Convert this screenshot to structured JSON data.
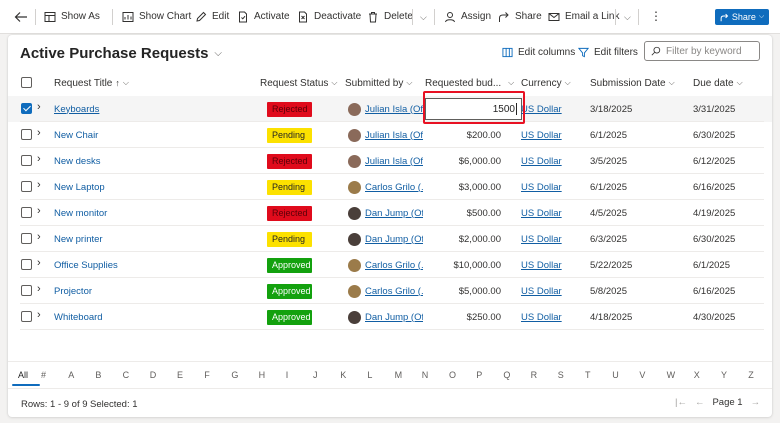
{
  "toolbar": {
    "show_as": "Show As",
    "show_chart": "Show Chart",
    "edit": "Edit",
    "activate": "Activate",
    "deactivate": "Deactivate",
    "delete": "Delete",
    "assign": "Assign",
    "share": "Share",
    "email_link": "Email a Link",
    "share_button": "Share"
  },
  "view": {
    "title": "Active Purchase Requests",
    "edit_columns": "Edit columns",
    "edit_filters": "Edit filters",
    "search_placeholder": "Filter by keyword"
  },
  "columns": {
    "title": "Request Title",
    "status": "Request Status",
    "submitted_by": "Submitted by",
    "budget": "Requested bud...",
    "currency": "Currency",
    "submission": "Submission Date",
    "due": "Due date"
  },
  "rows": [
    {
      "title": "Keyboards",
      "status": "Rejected",
      "submitter": "Julian Isla (Off...",
      "budget": "1500",
      "currency": "US Dollar",
      "submission": "3/18/2025",
      "due": "3/31/2025"
    },
    {
      "title": "New Chair",
      "status": "Pending",
      "submitter": "Julian Isla (Off...",
      "budget": "$200.00",
      "currency": "US Dollar",
      "submission": "6/1/2025",
      "due": "6/30/2025"
    },
    {
      "title": "New desks",
      "status": "Rejected",
      "submitter": "Julian Isla (Off...",
      "budget": "$6,000.00",
      "currency": "US Dollar",
      "submission": "3/5/2025",
      "due": "6/12/2025"
    },
    {
      "title": "New Laptop",
      "status": "Pending",
      "submitter": "Carlos Grilo (...",
      "budget": "$3,000.00",
      "currency": "US Dollar",
      "submission": "6/1/2025",
      "due": "6/16/2025"
    },
    {
      "title": "New monitor",
      "status": "Rejected",
      "submitter": "Dan Jump (Of...",
      "budget": "$500.00",
      "currency": "US Dollar",
      "submission": "4/5/2025",
      "due": "4/19/2025"
    },
    {
      "title": "New printer",
      "status": "Pending",
      "submitter": "Dan Jump (Of...",
      "budget": "$2,000.00",
      "currency": "US Dollar",
      "submission": "6/3/2025",
      "due": "6/30/2025"
    },
    {
      "title": "Office Supplies",
      "status": "Approved",
      "submitter": "Carlos Grilo (...",
      "budget": "$10,000.00",
      "currency": "US Dollar",
      "submission": "5/22/2025",
      "due": "6/1/2025"
    },
    {
      "title": "Projector",
      "status": "Approved",
      "submitter": "Carlos Grilo (...",
      "budget": "$5,000.00",
      "currency": "US Dollar",
      "submission": "5/8/2025",
      "due": "6/16/2025"
    },
    {
      "title": "Whiteboard",
      "status": "Approved",
      "submitter": "Dan Jump (Of...",
      "budget": "$250.00",
      "currency": "US Dollar",
      "submission": "4/18/2025",
      "due": "4/30/2025"
    }
  ],
  "status_colors": {
    "Rejected": "#e00b1c",
    "Pending": "#fce100",
    "Approved": "#13a10e"
  },
  "alphabet": [
    "All",
    "#",
    "A",
    "B",
    "C",
    "D",
    "E",
    "F",
    "G",
    "H",
    "I",
    "J",
    "K",
    "L",
    "M",
    "N",
    "O",
    "P",
    "Q",
    "R",
    "S",
    "T",
    "U",
    "V",
    "W",
    "X",
    "Y",
    "Z"
  ],
  "footer": {
    "rows_label": "Rows: 1 - 9 of 9",
    "selected_label": "Selected: 1",
    "page_label": "Page 1"
  }
}
